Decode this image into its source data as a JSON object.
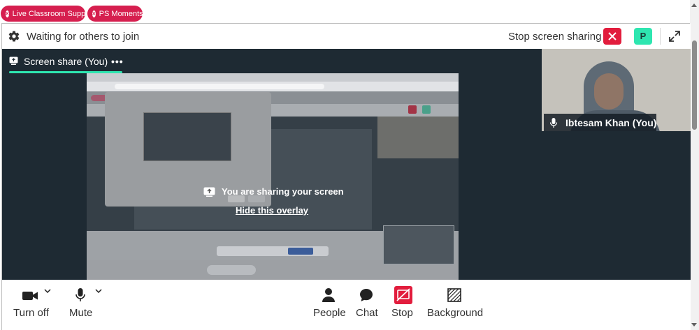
{
  "top_pills": [
    {
      "label": "Live Classroom Support"
    },
    {
      "label": "PS Moments"
    }
  ],
  "header": {
    "status_text": "Waiting for others to join",
    "stop_screen_sharing": "Stop screen sharing",
    "avatar_letter": "P"
  },
  "stage": {
    "tab_label": "Screen share (You)",
    "sharing_message": "You are sharing your screen",
    "hide_overlay": "Hide this overlay"
  },
  "self_video": {
    "name": "Ibtesam Khan (You)"
  },
  "toolbar": {
    "camera_label": "Turn off",
    "mic_label": "Mute",
    "people_label": "People",
    "chat_label": "Chat",
    "stop_label": "Stop",
    "background_label": "Background"
  },
  "colors": {
    "accent_red": "#e21d3d",
    "accent_teal": "#2ee6b0",
    "pill_red": "#d61f4f",
    "stage_bg": "#1e2a33"
  }
}
